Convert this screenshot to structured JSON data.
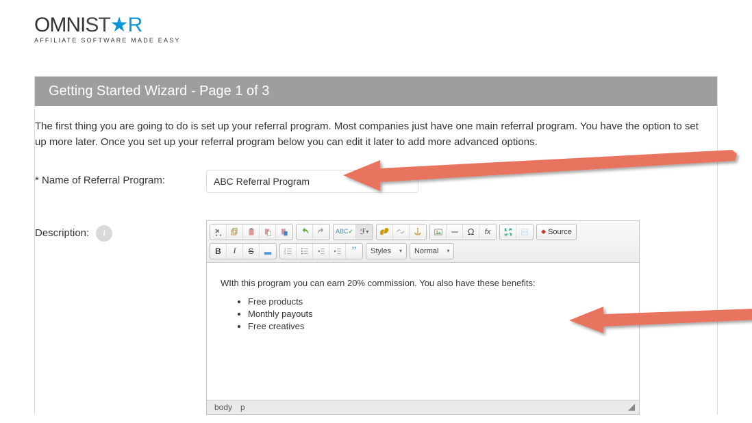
{
  "logo": {
    "text1": "OMNI",
    "text2": "ST",
    "star": "★",
    "text3": "R",
    "tagline": "AFFILIATE SOFTWARE MADE EASY"
  },
  "title": "Getting Started Wizard - Page 1 of 3",
  "intro": "The first thing you are going to do is set up your referral program. Most companies just have one main referral program. You have the option to set up more later. Once you set up your referral program below you can edit it later to add more advanced options.",
  "fields": {
    "name_label": "* Name of Referral Program:",
    "name_value": "ABC Referral Program",
    "desc_label": "Description:"
  },
  "editor": {
    "toolbar": {
      "styles_label": "Styles",
      "format_label": "Normal",
      "source_label": "Source"
    },
    "content_text": "WIth this program you can earn 20% commission. You also have these benefits:",
    "bullets": [
      "Free products",
      "Monthly payouts",
      "Free creatives"
    ],
    "path": {
      "body": "body",
      "p": "p"
    }
  },
  "icons": {
    "info": "i"
  }
}
